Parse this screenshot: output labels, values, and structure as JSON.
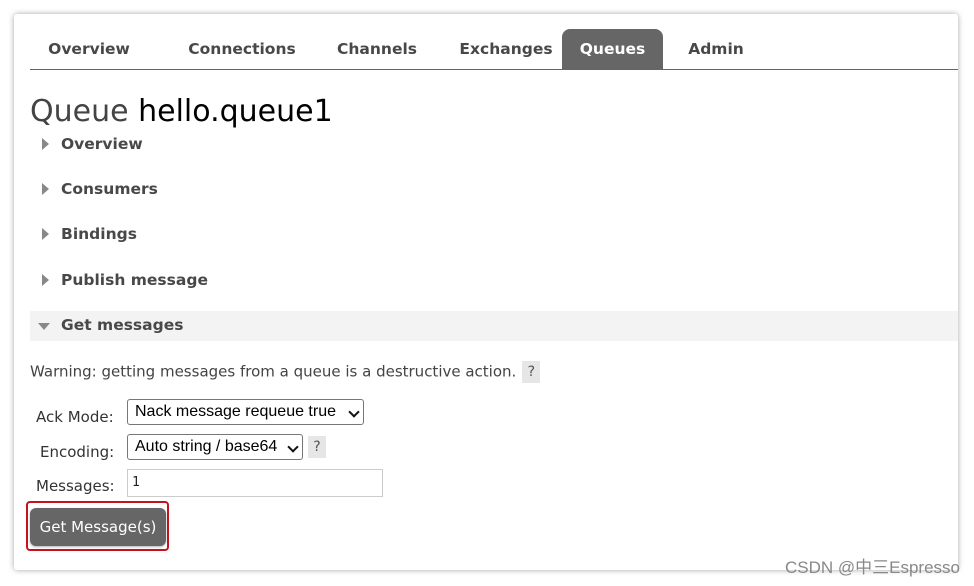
{
  "nav": {
    "tabs": [
      {
        "label": "Overview"
      },
      {
        "label": "Connections"
      },
      {
        "label": "Channels"
      },
      {
        "label": "Exchanges"
      },
      {
        "label": "Queues",
        "active": true
      },
      {
        "label": "Admin"
      }
    ]
  },
  "page": {
    "title_prefix": "Queue",
    "queue_name": "hello.queue1"
  },
  "sections": [
    {
      "label": "Overview",
      "expanded": false
    },
    {
      "label": "Consumers",
      "expanded": false
    },
    {
      "label": "Bindings",
      "expanded": false
    },
    {
      "label": "Publish message",
      "expanded": false
    },
    {
      "label": "Get messages",
      "expanded": true
    }
  ],
  "get_messages": {
    "warning": "Warning: getting messages from a queue is a destructive action.",
    "help_label": "?",
    "ack_mode_label": "Ack Mode:",
    "ack_mode_value": "Nack message requeue true",
    "encoding_label": "Encoding:",
    "encoding_value": "Auto string / base64",
    "encoding_help": "?",
    "messages_label": "Messages:",
    "messages_value": "1",
    "button_label": "Get Message(s)"
  },
  "watermark": "CSDN @中三Espresso",
  "colors": {
    "tab_active_bg": "#666666",
    "button_bg": "#666666",
    "highlight_border": "#c8121b",
    "section_open_bg": "#f3f3f3"
  }
}
